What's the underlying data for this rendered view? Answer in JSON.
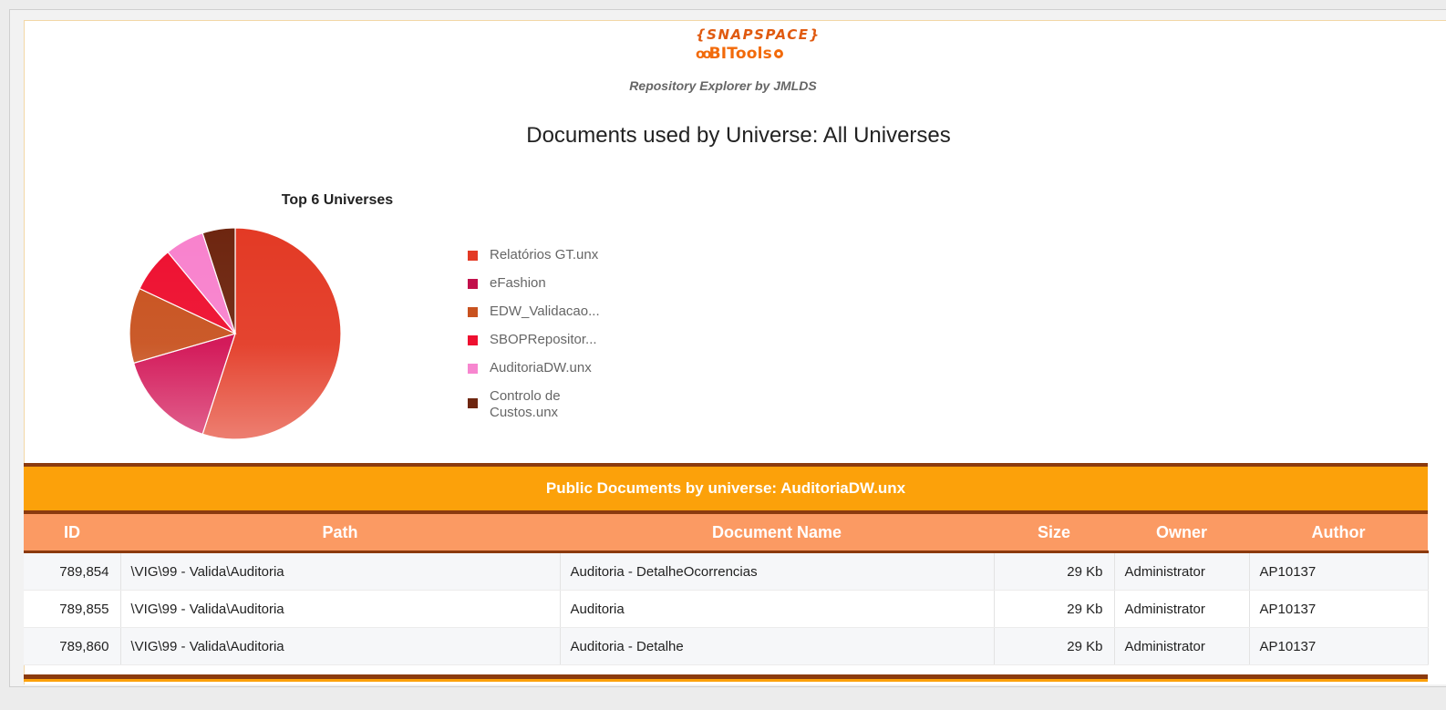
{
  "logo": {
    "line1": "{SNAPSPACE}",
    "line2_prefix": "oo",
    "line2_text": "BITools"
  },
  "header": {
    "subtitle": "Repository Explorer by JMLDS",
    "title": "Documents used by Universe: All Universes"
  },
  "chart_data": {
    "type": "pie",
    "title": "Top 6 Universes",
    "categories": [
      "Relatórios GT.unx",
      "eFashion",
      "EDW_Validacao...",
      "SBOPRepositor...",
      "AuditoriaDW.unx",
      "Controlo de Custos.unx"
    ],
    "values": [
      55,
      15.5,
      11.5,
      7,
      6,
      5
    ],
    "colors": [
      "#e33a25",
      "#d10f52",
      "#c8521f",
      "#ee1030",
      "#f882cd",
      "#6e2610"
    ],
    "legend_position": "right"
  },
  "legend": {
    "items": [
      {
        "label": "Relatórios GT.unx",
        "color": "#e33a25"
      },
      {
        "label": "eFashion",
        "color": "#c2104b"
      },
      {
        "label": "EDW_Validacao...",
        "color": "#c8521f"
      },
      {
        "label": "SBOPRepositor...",
        "color": "#ee1030"
      },
      {
        "label": "AuditoriaDW.unx",
        "color": "#f786cf"
      },
      {
        "label": "Controlo de Custos.unx",
        "color": "#6e2610"
      }
    ]
  },
  "section": {
    "title": "Public Documents by universe: AuditoriaDW.unx"
  },
  "table": {
    "headers": [
      "ID",
      "Path",
      "Document Name",
      "Size",
      "Owner",
      "Author"
    ],
    "rows": [
      [
        "789,854",
        "\\VIG\\99 - Valida\\Auditoria",
        "Auditoria - DetalheOcorrencias",
        "29 Kb",
        "Administrator",
        "AP10137"
      ],
      [
        "789,855",
        "\\VIG\\99 - Valida\\Auditoria",
        "Auditoria",
        "29 Kb",
        "Administrator",
        "AP10137"
      ],
      [
        "789,860",
        "\\VIG\\99 - Valida\\Auditoria",
        "Auditoria - Detalhe",
        "29 Kb",
        "Administrator",
        "AP10137"
      ]
    ]
  },
  "colors": {
    "accent": "#fca10a",
    "header_row": "#fb9a63",
    "dark_rule": "#8b3a0e"
  }
}
